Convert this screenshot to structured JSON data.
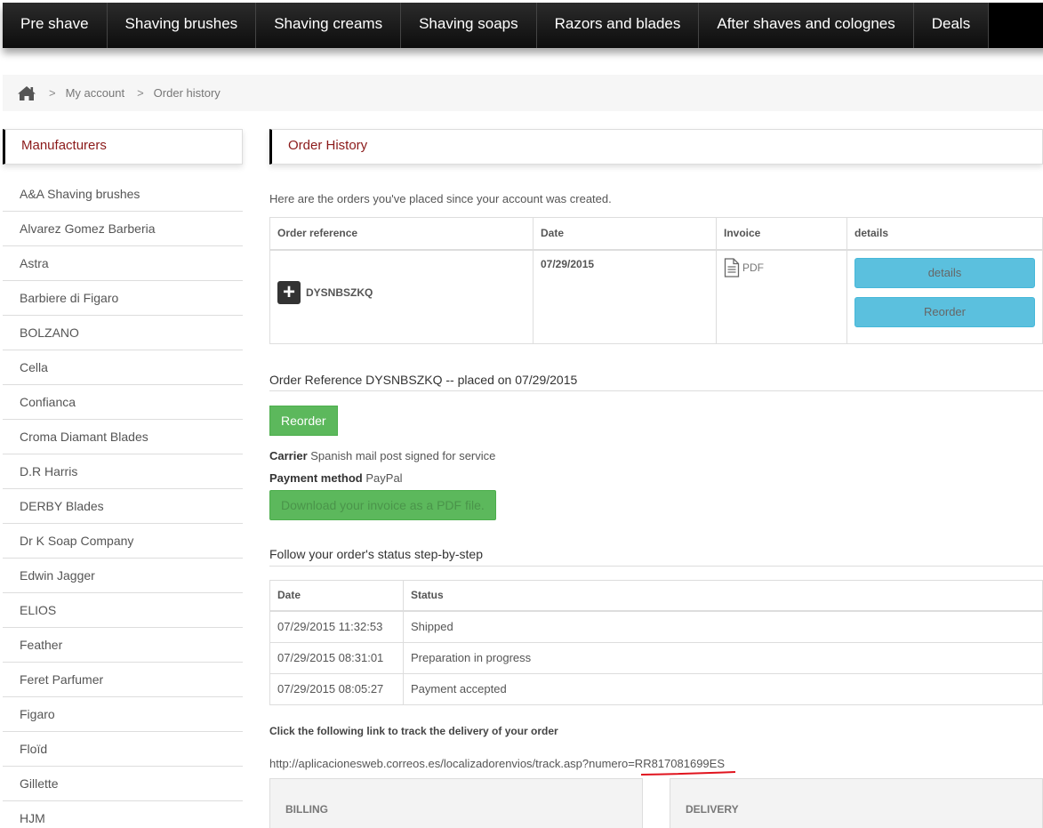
{
  "nav": {
    "items": [
      "Pre shave",
      "Shaving brushes",
      "Shaving creams",
      "Shaving soaps",
      "Razors and blades",
      "After shaves and colognes",
      "Deals"
    ]
  },
  "breadcrumb": {
    "separator": ">",
    "items": [
      "My account",
      "Order history"
    ]
  },
  "sidebar": {
    "title": "Manufacturers",
    "items": [
      "A&A Shaving brushes",
      "Alvarez Gomez Barberia",
      "Astra",
      "Barbiere di Figaro",
      "BOLZANO",
      "Cella",
      "Confianca",
      "Croma Diamant Blades",
      "D.R Harris",
      "DERBY Blades",
      "Dr K Soap Company",
      "Edwin Jagger",
      "ELIOS",
      "Feather",
      "Feret Parfumer",
      "Figaro",
      "Floïd",
      "Gillette",
      "HJM"
    ]
  },
  "main": {
    "title": "Order History",
    "intro": "Here are the orders you've placed since your account was created.",
    "orders_table": {
      "headers": [
        "Order reference",
        "Date",
        "Invoice",
        "details"
      ],
      "rows": [
        {
          "reference": "DYSNBSZKQ",
          "date": "07/29/2015",
          "invoice": "PDF",
          "details_label": "details",
          "reorder_label": "Reorder"
        }
      ]
    },
    "order_detail": {
      "heading": "Order Reference DYSNBSZKQ -- placed on 07/29/2015",
      "reorder_label": "Reorder",
      "carrier_label": "Carrier",
      "carrier_value": "Spanish mail post signed for service",
      "payment_label": "Payment method",
      "payment_value": "PayPal",
      "download_label": "Download your invoice as a PDF file."
    },
    "status": {
      "heading": "Follow your order's status step-by-step",
      "headers": [
        "Date",
        "Status"
      ],
      "rows": [
        {
          "date": "07/29/2015 11:32:53",
          "status": "Shipped"
        },
        {
          "date": "07/29/2015 08:31:01",
          "status": "Preparation in progress"
        },
        {
          "date": "07/29/2015 08:05:27",
          "status": "Payment accepted"
        }
      ]
    },
    "tracking": {
      "label": "Click the following link to track the delivery of your order",
      "url": "http://aplicacionesweb.correos.es/localizadorenvios/track.asp?numero=RR817081699ES"
    },
    "addresses": {
      "billing": "BILLING",
      "delivery": "DELIVERY"
    }
  },
  "colors": {
    "accent_red": "#8b1a1a",
    "button_blue": "#5bc0de",
    "button_green": "#5cb85c",
    "annotation_red": "#e0141e"
  }
}
